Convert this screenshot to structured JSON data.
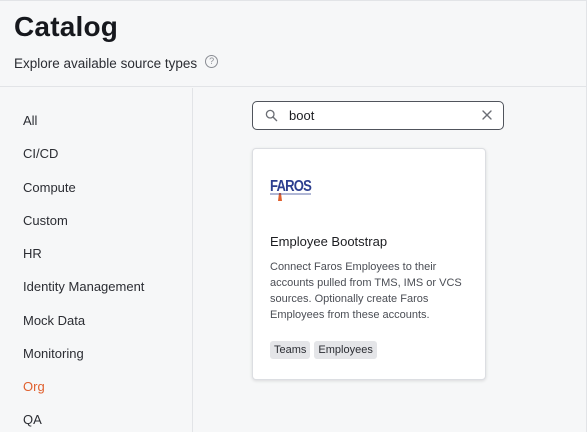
{
  "header": {
    "title": "Catalog",
    "subtitle": "Explore available source types",
    "help_icon_glyph": "?"
  },
  "sidebar": {
    "active_color": "#e0602e",
    "items": [
      {
        "label": "All"
      },
      {
        "label": "CI/CD"
      },
      {
        "label": "Compute"
      },
      {
        "label": "Custom"
      },
      {
        "label": "HR"
      },
      {
        "label": "Identity Management"
      },
      {
        "label": "Mock Data"
      },
      {
        "label": "Monitoring"
      },
      {
        "label": "Org",
        "active": true
      },
      {
        "label": "QA"
      }
    ]
  },
  "search": {
    "value": "boot",
    "icon": "search-icon",
    "clear_icon": "close-icon"
  },
  "cards": [
    {
      "logo_text": "FAROS",
      "title": "Employee Bootstrap",
      "description": "Connect Faros Employees to their accounts pulled from TMS, IMS or VCS sources. Optionally create Faros Employees from these accounts.",
      "tags": [
        "Teams",
        "Employees"
      ]
    }
  ]
}
